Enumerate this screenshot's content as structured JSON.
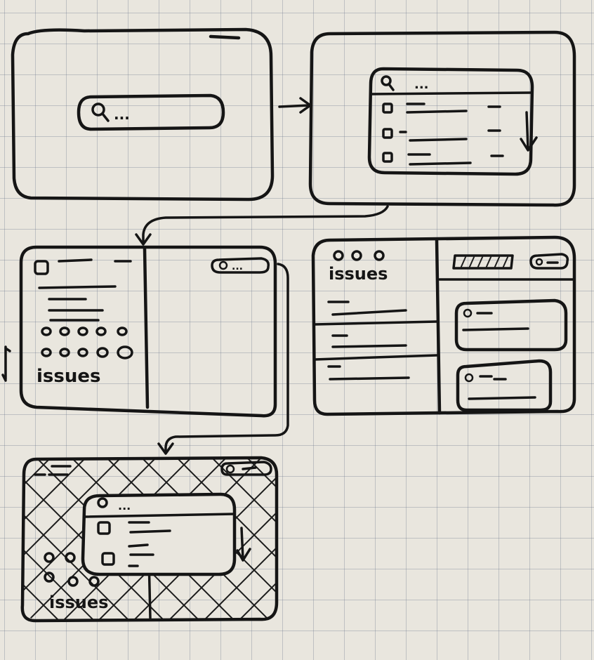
{
  "labels": {
    "search_placeholder_1": "...",
    "search_placeholder_2": "...",
    "issues_panel_3": "issues",
    "issues_panel_4": "issues",
    "issues_panel_5": "issues",
    "overlay_search_placeholder": "...",
    "top_right_search_placeholder": "..."
  },
  "colors": {
    "ink": "#151515",
    "paper": "#e9e6de",
    "grid": "#6e788c"
  }
}
